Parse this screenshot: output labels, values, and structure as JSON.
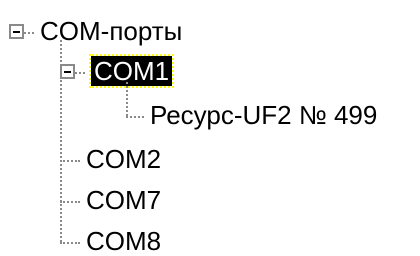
{
  "tree": {
    "root": {
      "label": "COM-порты",
      "expanded": true,
      "children": [
        {
          "label": "COM1",
          "selected": true,
          "expanded": true,
          "children": [
            {
              "label": "Ресурс-UF2  № 499"
            }
          ]
        },
        {
          "label": "COM2"
        },
        {
          "label": "COM7"
        },
        {
          "label": "COM8"
        }
      ]
    }
  },
  "icons": {
    "collapse": "minus-box-icon"
  },
  "colors": {
    "selection_bg": "#000000",
    "selection_text": "#ffffff",
    "selection_focus": "#ffff00",
    "tree_lines": "#8a8a8a"
  }
}
